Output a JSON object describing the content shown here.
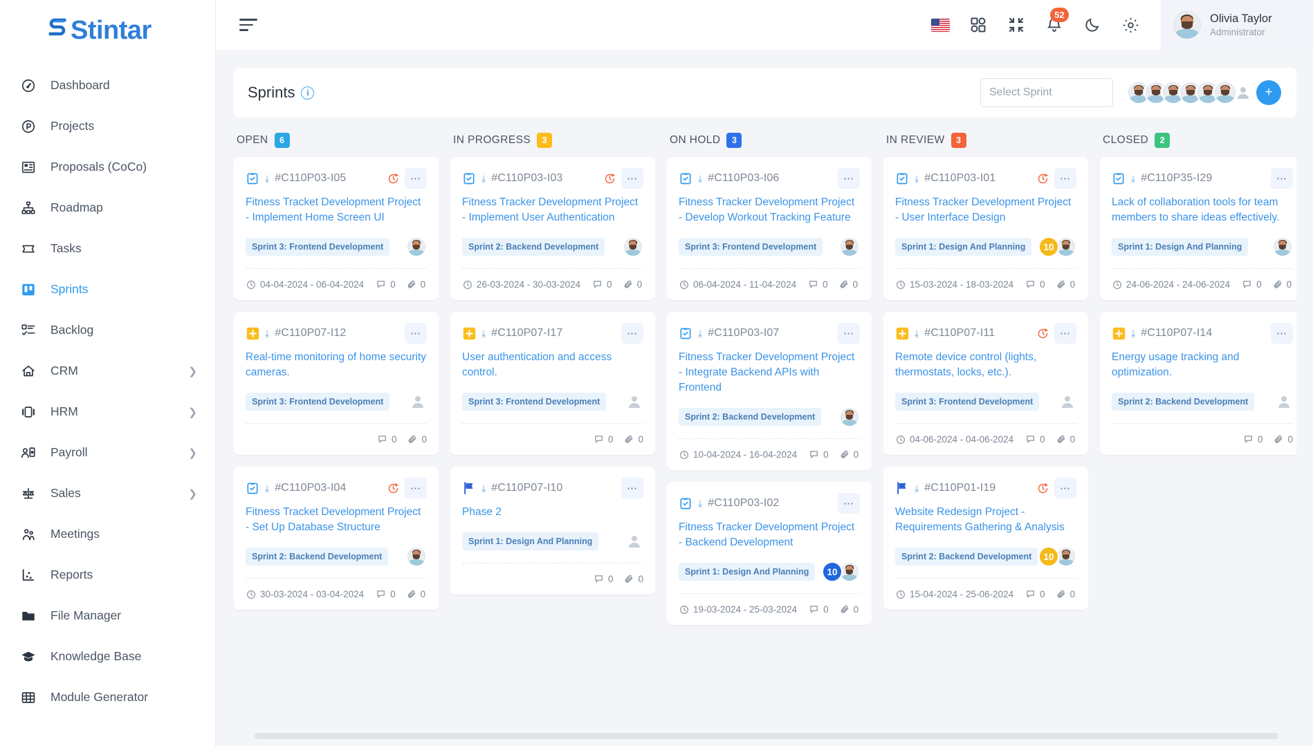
{
  "brand": {
    "name": "Stintar"
  },
  "sidebar": {
    "items": [
      {
        "label": "Dashboard",
        "icon": "gauge-icon",
        "active": false,
        "chevron": false
      },
      {
        "label": "Projects",
        "icon": "project-circle-icon",
        "active": false,
        "chevron": false
      },
      {
        "label": "Proposals (CoCo)",
        "icon": "proposal-icon",
        "active": false,
        "chevron": false
      },
      {
        "label": "Roadmap",
        "icon": "roadmap-icon",
        "active": false,
        "chevron": false
      },
      {
        "label": "Tasks",
        "icon": "tasks-icon",
        "active": false,
        "chevron": false
      },
      {
        "label": "Sprints",
        "icon": "sprints-board-icon",
        "active": true,
        "chevron": false
      },
      {
        "label": "Backlog",
        "icon": "backlog-icon",
        "active": false,
        "chevron": false
      },
      {
        "label": "CRM",
        "icon": "crm-icon",
        "active": false,
        "chevron": true
      },
      {
        "label": "HRM",
        "icon": "hrm-icon",
        "active": false,
        "chevron": true
      },
      {
        "label": "Payroll",
        "icon": "payroll-icon",
        "active": false,
        "chevron": true
      },
      {
        "label": "Sales",
        "icon": "scales-icon",
        "active": false,
        "chevron": true
      },
      {
        "label": "Meetings",
        "icon": "meetings-icon",
        "active": false,
        "chevron": false
      },
      {
        "label": "Reports",
        "icon": "reports-icon",
        "active": false,
        "chevron": false
      },
      {
        "label": "File Manager",
        "icon": "folder-icon",
        "active": false,
        "chevron": false
      },
      {
        "label": "Knowledge Base",
        "icon": "graduation-cap-icon",
        "active": false,
        "chevron": false
      },
      {
        "label": "Module Generator",
        "icon": "grid-table-icon",
        "active": false,
        "chevron": false
      }
    ]
  },
  "topbar": {
    "menu_icon": "hamburger-icon",
    "language_icon": "us-flag-icon",
    "apps_icon": "apps-grid-icon",
    "fullscreen_icon": "compress-icon",
    "notifications_icon": "bell-icon",
    "notifications_count": "52",
    "theme_icon": "moon-icon",
    "settings_icon": "gear-icon",
    "user": {
      "name": "Olivia Taylor",
      "role": "Administrator",
      "avatar": "user-avatar"
    }
  },
  "page": {
    "title": "Sprints",
    "info_icon": "info-icon",
    "select_sprint_placeholder": "Select Sprint",
    "team_avatars": 6,
    "add_member_label": "+",
    "add_member_icon": "plus-icon"
  },
  "colors": {
    "open": "#29a7e6",
    "in_progress": "#fcbc1d",
    "on_hold": "#2f71e8",
    "in_review": "#f4633a",
    "closed": "#3dc47e",
    "accent": "#2f9bf0",
    "link": "#3b93e8",
    "badge_yellow": "#f5b91a",
    "badge_blue": "#1f66e0"
  },
  "board": {
    "columns": [
      {
        "name": "OPEN",
        "count": "6",
        "color_key": "open",
        "cards": [
          {
            "type_icon": "task-clipboard-icon",
            "id": "#C110P03-I05",
            "title": "Fitness Tracket Development Project - Implement Home Screen UI",
            "sprint": "Sprint 3: Frontend Development",
            "badge": null,
            "badge_color": null,
            "assignee": "photo",
            "overdue": true,
            "dates": "04-04-2024 - 06-04-2024",
            "comments": "0",
            "attachments": "0"
          },
          {
            "type_icon": "feature-plus-icon",
            "id": "#C110P07-I12",
            "title": "Real-time monitoring of home security cameras.",
            "sprint": "Sprint 3: Frontend Development",
            "badge": null,
            "badge_color": null,
            "assignee": "ghost",
            "overdue": false,
            "dates": "",
            "comments": "0",
            "attachments": "0"
          },
          {
            "type_icon": "task-clipboard-icon",
            "id": "#C110P03-I04",
            "title": "Fitness Tracket Development Project - Set Up Database Structure",
            "sprint": "Sprint 2: Backend Development",
            "badge": null,
            "badge_color": null,
            "assignee": "photo",
            "overdue": true,
            "dates": "30-03-2024 - 03-04-2024",
            "comments": "0",
            "attachments": "0"
          }
        ]
      },
      {
        "name": "IN PROGRESS",
        "count": "3",
        "color_key": "in_progress",
        "cards": [
          {
            "type_icon": "task-clipboard-icon",
            "id": "#C110P03-I03",
            "title": "Fitness Tracker Development Project - Implement User Authentication",
            "sprint": "Sprint 2: Backend Development",
            "badge": null,
            "badge_color": null,
            "assignee": "photo",
            "overdue": true,
            "dates": "26-03-2024 - 30-03-2024",
            "comments": "0",
            "attachments": "0"
          },
          {
            "type_icon": "feature-plus-icon",
            "id": "#C110P07-I17",
            "title": "User authentication and access control.",
            "sprint": "Sprint 3: Frontend Development",
            "badge": null,
            "badge_color": null,
            "assignee": "ghost",
            "overdue": false,
            "dates": "",
            "comments": "0",
            "attachments": "0"
          },
          {
            "type_icon": "flag-icon",
            "id": "#C110P07-I10",
            "title": "Phase 2",
            "sprint": "Sprint 1: Design And Planning",
            "badge": null,
            "badge_color": null,
            "assignee": "ghost",
            "overdue": false,
            "dates": "",
            "comments": "0",
            "attachments": "0"
          }
        ]
      },
      {
        "name": "ON HOLD",
        "count": "3",
        "color_key": "on_hold",
        "cards": [
          {
            "type_icon": "task-clipboard-icon",
            "id": "#C110P03-I06",
            "title": "Fitness Tracker Development Project - Develop Workout Tracking Feature",
            "sprint": "Sprint 3: Frontend Development",
            "badge": null,
            "badge_color": null,
            "assignee": "photo",
            "overdue": false,
            "dates": "06-04-2024 - 11-04-2024",
            "comments": "0",
            "attachments": "0"
          },
          {
            "type_icon": "task-clipboard-icon",
            "id": "#C110P03-I07",
            "title": "Fitness Tracker Development Project - Integrate Backend APIs with Frontend",
            "sprint": "Sprint 2: Backend Development",
            "badge": null,
            "badge_color": null,
            "assignee": "photo",
            "overdue": false,
            "dates": "10-04-2024 - 16-04-2024",
            "comments": "0",
            "attachments": "0"
          },
          {
            "type_icon": "task-clipboard-icon",
            "id": "#C110P03-I02",
            "title": "Fitness Tracker Development Project - Backend Development",
            "sprint": "Sprint 1: Design And Planning",
            "badge": "10",
            "badge_color": "#1f66e0",
            "assignee": "photo",
            "overdue": false,
            "dates": "19-03-2024 - 25-03-2024",
            "comments": "0",
            "attachments": "0"
          }
        ]
      },
      {
        "name": "IN REVIEW",
        "count": "3",
        "color_key": "in_review",
        "cards": [
          {
            "type_icon": "task-clipboard-icon",
            "id": "#C110P03-I01",
            "title": "Fitness Tracker Development Project - User Interface Design",
            "sprint": "Sprint 1: Design And Planning",
            "badge": "10",
            "badge_color": "#f5b91a",
            "assignee": "photo",
            "overdue": true,
            "dates": "15-03-2024 - 18-03-2024",
            "comments": "0",
            "attachments": "0"
          },
          {
            "type_icon": "feature-plus-icon",
            "id": "#C110P07-I11",
            "title": "Remote device control (lights, thermostats, locks, etc.).",
            "sprint": "Sprint 3: Frontend Development",
            "badge": null,
            "badge_color": null,
            "assignee": "ghost",
            "overdue": true,
            "dates": "04-06-2024 - 04-06-2024",
            "comments": "0",
            "attachments": "0"
          },
          {
            "type_icon": "flag-icon",
            "id": "#C110P01-I19",
            "title": "Website Redesign Project - Requirements Gathering & Analysis",
            "sprint": "Sprint 2: Backend Development",
            "badge": "10",
            "badge_color": "#f5b91a",
            "assignee": "photo",
            "overdue": true,
            "dates": "15-04-2024 - 25-06-2024",
            "comments": "0",
            "attachments": "0"
          }
        ]
      },
      {
        "name": "CLOSED",
        "count": "2",
        "color_key": "closed",
        "cards": [
          {
            "type_icon": "task-clipboard-icon",
            "id": "#C110P35-I29",
            "title": "Lack of collaboration tools for team members to share ideas effectively.",
            "sprint": "Sprint 1: Design And Planning",
            "badge": null,
            "badge_color": null,
            "assignee": "photo",
            "overdue": false,
            "dates": "24-06-2024 - 24-06-2024",
            "comments": "0",
            "attachments": "0"
          },
          {
            "type_icon": "feature-plus-icon",
            "id": "#C110P07-I14",
            "title": "Energy usage tracking and optimization.",
            "sprint": "Sprint 2: Backend Development",
            "badge": null,
            "badge_color": null,
            "assignee": "ghost",
            "overdue": false,
            "dates": "",
            "comments": "0",
            "attachments": "0"
          }
        ]
      }
    ]
  }
}
